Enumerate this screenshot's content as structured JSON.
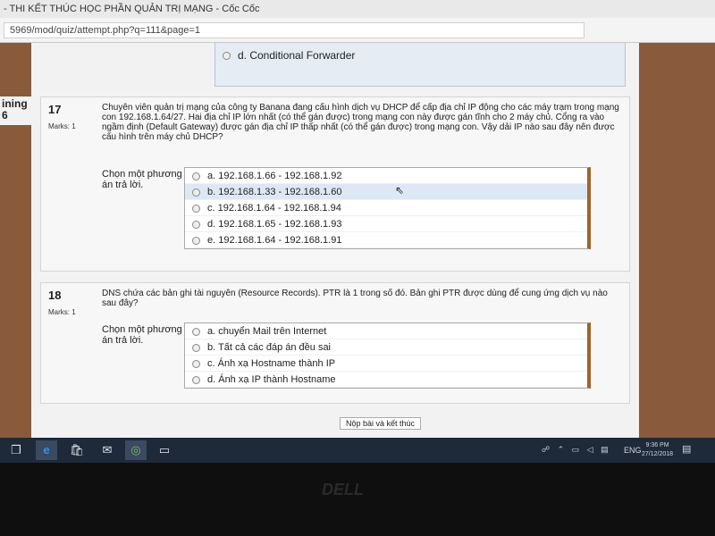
{
  "browser": {
    "title": "- THI KẾT THÚC HỌC PHẦN QUẢN TRỊ MẠNG - Cốc Cốc",
    "url": "5969/mod/quiz/attempt.php?q=111&page=1"
  },
  "side": {
    "line1": "ining",
    "line2": "6"
  },
  "prev_question": {
    "visible_option": "d. Conditional Forwarder"
  },
  "questions": [
    {
      "number": "17",
      "marks": "Marks: 1",
      "text": "Chuyên viên quản trị mạng của công ty Banana đang cấu hình dịch vụ DHCP để cấp địa chỉ IP động cho các máy trạm trong mạng con 192.168.1.64/27. Hai địa chỉ IP lớn nhất (có thể gán được) trong mạng con này được gán tĩnh cho 2 máy chủ. Cổng ra vào ngầm định (Default Gateway) được gán địa chỉ IP thấp nhất (có thể gán được) trong mạng con. Vậy dải IP nào sau đây nên được cấu hình trên máy chủ DHCP?",
      "prompt": "Chọn một phương án trả lời.",
      "options": [
        "a. 192.168.1.66 - 192.168.1.92",
        "b. 192.168.1.33 - 192.168.1.60",
        "c. 192.168.1.64 - 192.168.1.94",
        "d. 192.168.1.65 - 192.168.1.93",
        "e. 192.168.1.64 - 192.168.1.91"
      ]
    },
    {
      "number": "18",
      "marks": "Marks: 1",
      "text": "DNS chứa các bản ghi tài nguyên (Resource Records). PTR là 1 trong số đó. Bản ghi PTR được dùng để cung ứng dịch vụ nào sau đây?",
      "prompt": "Chọn một phương án trả lời.",
      "options": [
        "a. chuyển Mail trên Internet",
        "b. Tất cả các đáp án đều sai",
        "c. Ánh xạ Hostname thành IP",
        "d. Ánh xạ IP thành Hostname"
      ]
    }
  ],
  "submit_label": "Nộp bài và kết thúc",
  "taskbar": {
    "lang": "ENG",
    "time": "9:36 PM",
    "date": "27/12/2018"
  },
  "brand": "DELL"
}
